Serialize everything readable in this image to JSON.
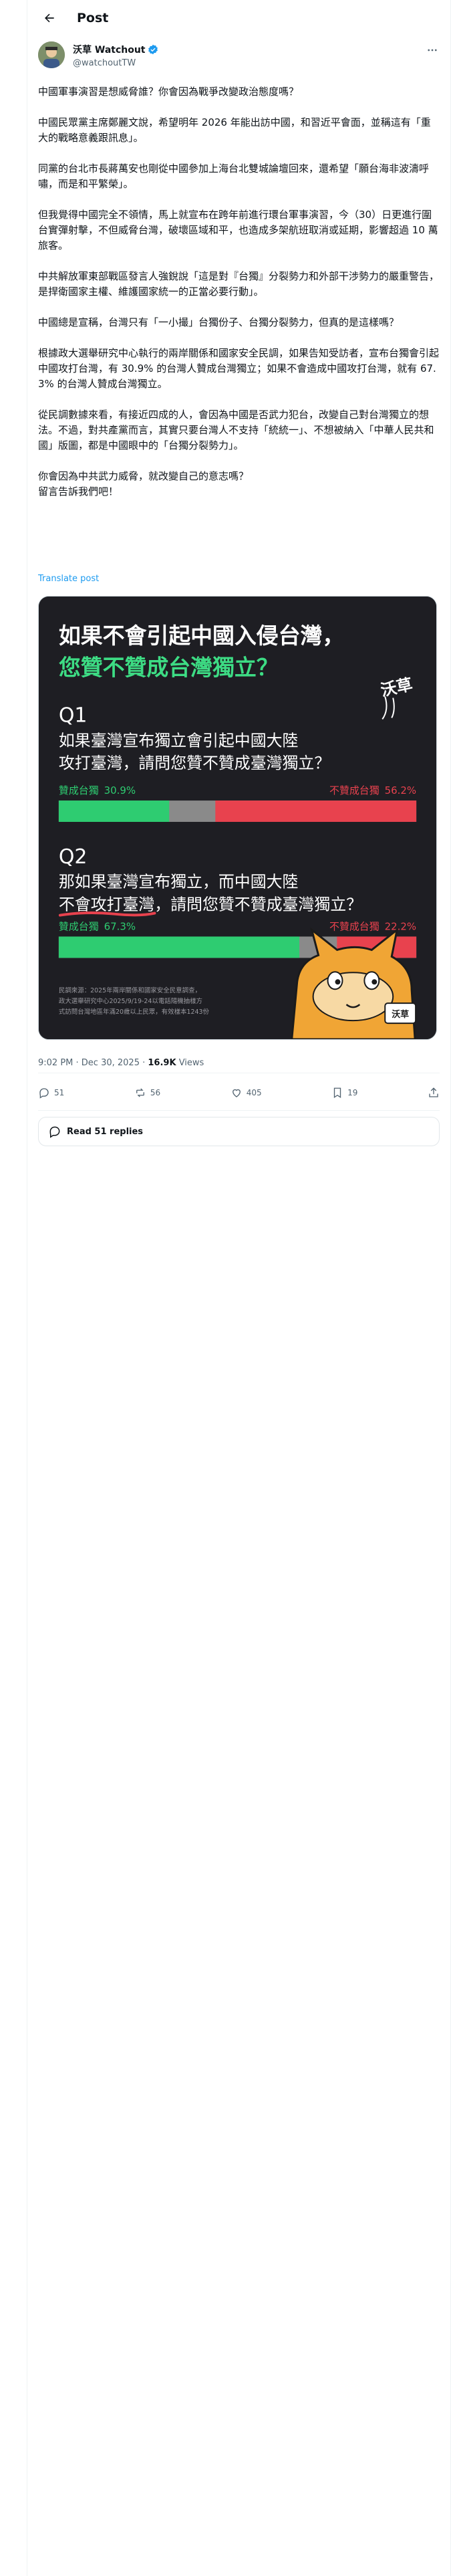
{
  "header": {
    "title": "Post"
  },
  "author": {
    "name": "沃草 Watchout",
    "handle": "@watchoutTW"
  },
  "post": {
    "paragraphs": [
      "中國軍事演習是想威脅誰？你會因為戰爭改變政治態度嗎？",
      "中國民眾黨主席鄭麗文說，希望明年 2026 年能出訪中國，和習近平會面，並稱這有「重大的戰略意義跟訊息」。",
      "同黨的台北市長蔣萬安也剛從中國參加上海台北雙城論壇回來，還希望「願台海非波濤呼嘯，而是和平繁榮」。",
      "但我覺得中國完全不領情，馬上就宣布在跨年前進行環台軍事演習，今（30）日更進行圍台實彈射擊，不但威脅台灣，破壞區域和平，也造成多架航班取消或延期，影響超過 10 萬旅客。",
      "中共解放軍東部戰區發言人強銳說「這是對『台獨』分裂勢力和外部干涉勢力的嚴重警告，是捍衛國家主權、維護國家統一的正當必要行動」。",
      "中國總是宣稱，台灣只有「一小撮」台獨份子、台獨分裂勢力，但真的是這樣嗎？",
      "根據政大選舉研究中心執行的兩岸關係和國家安全民調，如果告知受訪者，宣布台獨會引起中國攻打台灣，有 30.9% 的台灣人贊成台灣獨立；如果不會造成中國攻打台灣，就有 67.3% 的台灣人贊成台灣獨立。",
      "從民調數據來看，有接近四成的人，會因為中國是否武力犯台，改變自己對台灣獨立的想法。不過，對共產黨而言，其實只要台灣人不支持「統統一」、不想被納入「中華人民共和國」版圖，都是中國眼中的「台獨分裂勢力」。",
      "你會因為中共武力威脅，就改變自己的意志嗎？\n留言告訴我們吧！"
    ],
    "translate_label": "Translate post",
    "time": "9:02 PM",
    "date": "Dec 30, 2025",
    "views_count": "16.9K",
    "views_label": "Views"
  },
  "infographic": {
    "title_line1": "如果不會引起中國入侵台灣，",
    "title_line2": "您贊不贊成台灣獨立？",
    "logo_text": "沃草",
    "q1": {
      "label": "Q1",
      "line1": "如果臺灣宣布獨立會引起中國大陸",
      "line2": "攻打臺灣，請問您贊不贊成臺灣獨立？",
      "agree_label": "贊成台獨",
      "agree_value": 30.9,
      "disagree_label": "不贊成台獨",
      "disagree_value": 56.2
    },
    "q2": {
      "label": "Q2",
      "line1": "那如果臺灣宣布獨立，而中國大陸",
      "line2a": "不會攻打臺灣",
      "line2b": "，請問您贊不贊成臺灣獨立？",
      "agree_label": "贊成台獨",
      "agree_value": 67.3,
      "disagree_label": "不贊成台獨",
      "disagree_value": 22.2
    },
    "source_line1": "民調來源：2025年兩岸關係和國家安全民意調查，",
    "source_line2": "政大選舉研究中心2025/9/19-24以電話隨機抽樣方",
    "source_line3": "式訪問台灣地區年滿20歲以上民眾，有效樣本1243份",
    "mascot_tag": "沃草",
    "colors": {
      "agree": "#2ecc71",
      "disagree": "#e8424e",
      "neutral": "#8a8a8a",
      "title_accent": "#3ddc84"
    }
  },
  "stats": {
    "replies": "51",
    "reposts": "56",
    "likes": "405",
    "bookmarks": "19"
  },
  "read_replies": "Read 51 replies"
}
